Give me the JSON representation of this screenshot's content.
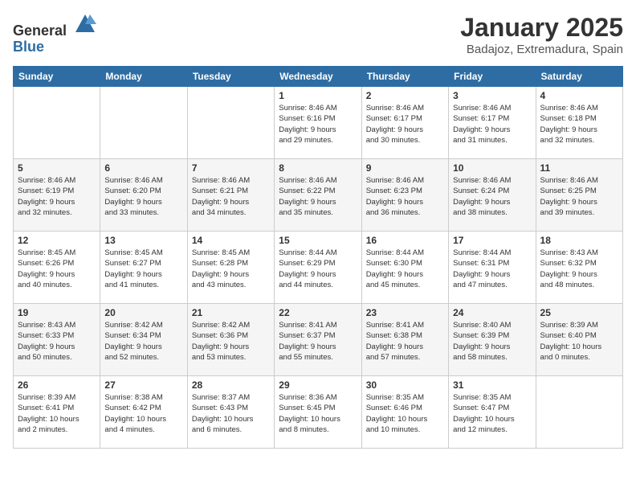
{
  "header": {
    "logo_general": "General",
    "logo_blue": "Blue",
    "month_title": "January 2025",
    "subtitle": "Badajoz, Extremadura, Spain"
  },
  "weekdays": [
    "Sunday",
    "Monday",
    "Tuesday",
    "Wednesday",
    "Thursday",
    "Friday",
    "Saturday"
  ],
  "weeks": [
    [
      {
        "day": "",
        "info": ""
      },
      {
        "day": "",
        "info": ""
      },
      {
        "day": "",
        "info": ""
      },
      {
        "day": "1",
        "info": "Sunrise: 8:46 AM\nSunset: 6:16 PM\nDaylight: 9 hours\nand 29 minutes."
      },
      {
        "day": "2",
        "info": "Sunrise: 8:46 AM\nSunset: 6:17 PM\nDaylight: 9 hours\nand 30 minutes."
      },
      {
        "day": "3",
        "info": "Sunrise: 8:46 AM\nSunset: 6:17 PM\nDaylight: 9 hours\nand 31 minutes."
      },
      {
        "day": "4",
        "info": "Sunrise: 8:46 AM\nSunset: 6:18 PM\nDaylight: 9 hours\nand 32 minutes."
      }
    ],
    [
      {
        "day": "5",
        "info": "Sunrise: 8:46 AM\nSunset: 6:19 PM\nDaylight: 9 hours\nand 32 minutes."
      },
      {
        "day": "6",
        "info": "Sunrise: 8:46 AM\nSunset: 6:20 PM\nDaylight: 9 hours\nand 33 minutes."
      },
      {
        "day": "7",
        "info": "Sunrise: 8:46 AM\nSunset: 6:21 PM\nDaylight: 9 hours\nand 34 minutes."
      },
      {
        "day": "8",
        "info": "Sunrise: 8:46 AM\nSunset: 6:22 PM\nDaylight: 9 hours\nand 35 minutes."
      },
      {
        "day": "9",
        "info": "Sunrise: 8:46 AM\nSunset: 6:23 PM\nDaylight: 9 hours\nand 36 minutes."
      },
      {
        "day": "10",
        "info": "Sunrise: 8:46 AM\nSunset: 6:24 PM\nDaylight: 9 hours\nand 38 minutes."
      },
      {
        "day": "11",
        "info": "Sunrise: 8:46 AM\nSunset: 6:25 PM\nDaylight: 9 hours\nand 39 minutes."
      }
    ],
    [
      {
        "day": "12",
        "info": "Sunrise: 8:45 AM\nSunset: 6:26 PM\nDaylight: 9 hours\nand 40 minutes."
      },
      {
        "day": "13",
        "info": "Sunrise: 8:45 AM\nSunset: 6:27 PM\nDaylight: 9 hours\nand 41 minutes."
      },
      {
        "day": "14",
        "info": "Sunrise: 8:45 AM\nSunset: 6:28 PM\nDaylight: 9 hours\nand 43 minutes."
      },
      {
        "day": "15",
        "info": "Sunrise: 8:44 AM\nSunset: 6:29 PM\nDaylight: 9 hours\nand 44 minutes."
      },
      {
        "day": "16",
        "info": "Sunrise: 8:44 AM\nSunset: 6:30 PM\nDaylight: 9 hours\nand 45 minutes."
      },
      {
        "day": "17",
        "info": "Sunrise: 8:44 AM\nSunset: 6:31 PM\nDaylight: 9 hours\nand 47 minutes."
      },
      {
        "day": "18",
        "info": "Sunrise: 8:43 AM\nSunset: 6:32 PM\nDaylight: 9 hours\nand 48 minutes."
      }
    ],
    [
      {
        "day": "19",
        "info": "Sunrise: 8:43 AM\nSunset: 6:33 PM\nDaylight: 9 hours\nand 50 minutes."
      },
      {
        "day": "20",
        "info": "Sunrise: 8:42 AM\nSunset: 6:34 PM\nDaylight: 9 hours\nand 52 minutes."
      },
      {
        "day": "21",
        "info": "Sunrise: 8:42 AM\nSunset: 6:36 PM\nDaylight: 9 hours\nand 53 minutes."
      },
      {
        "day": "22",
        "info": "Sunrise: 8:41 AM\nSunset: 6:37 PM\nDaylight: 9 hours\nand 55 minutes."
      },
      {
        "day": "23",
        "info": "Sunrise: 8:41 AM\nSunset: 6:38 PM\nDaylight: 9 hours\nand 57 minutes."
      },
      {
        "day": "24",
        "info": "Sunrise: 8:40 AM\nSunset: 6:39 PM\nDaylight: 9 hours\nand 58 minutes."
      },
      {
        "day": "25",
        "info": "Sunrise: 8:39 AM\nSunset: 6:40 PM\nDaylight: 10 hours\nand 0 minutes."
      }
    ],
    [
      {
        "day": "26",
        "info": "Sunrise: 8:39 AM\nSunset: 6:41 PM\nDaylight: 10 hours\nand 2 minutes."
      },
      {
        "day": "27",
        "info": "Sunrise: 8:38 AM\nSunset: 6:42 PM\nDaylight: 10 hours\nand 4 minutes."
      },
      {
        "day": "28",
        "info": "Sunrise: 8:37 AM\nSunset: 6:43 PM\nDaylight: 10 hours\nand 6 minutes."
      },
      {
        "day": "29",
        "info": "Sunrise: 8:36 AM\nSunset: 6:45 PM\nDaylight: 10 hours\nand 8 minutes."
      },
      {
        "day": "30",
        "info": "Sunrise: 8:35 AM\nSunset: 6:46 PM\nDaylight: 10 hours\nand 10 minutes."
      },
      {
        "day": "31",
        "info": "Sunrise: 8:35 AM\nSunset: 6:47 PM\nDaylight: 10 hours\nand 12 minutes."
      },
      {
        "day": "",
        "info": ""
      }
    ]
  ]
}
